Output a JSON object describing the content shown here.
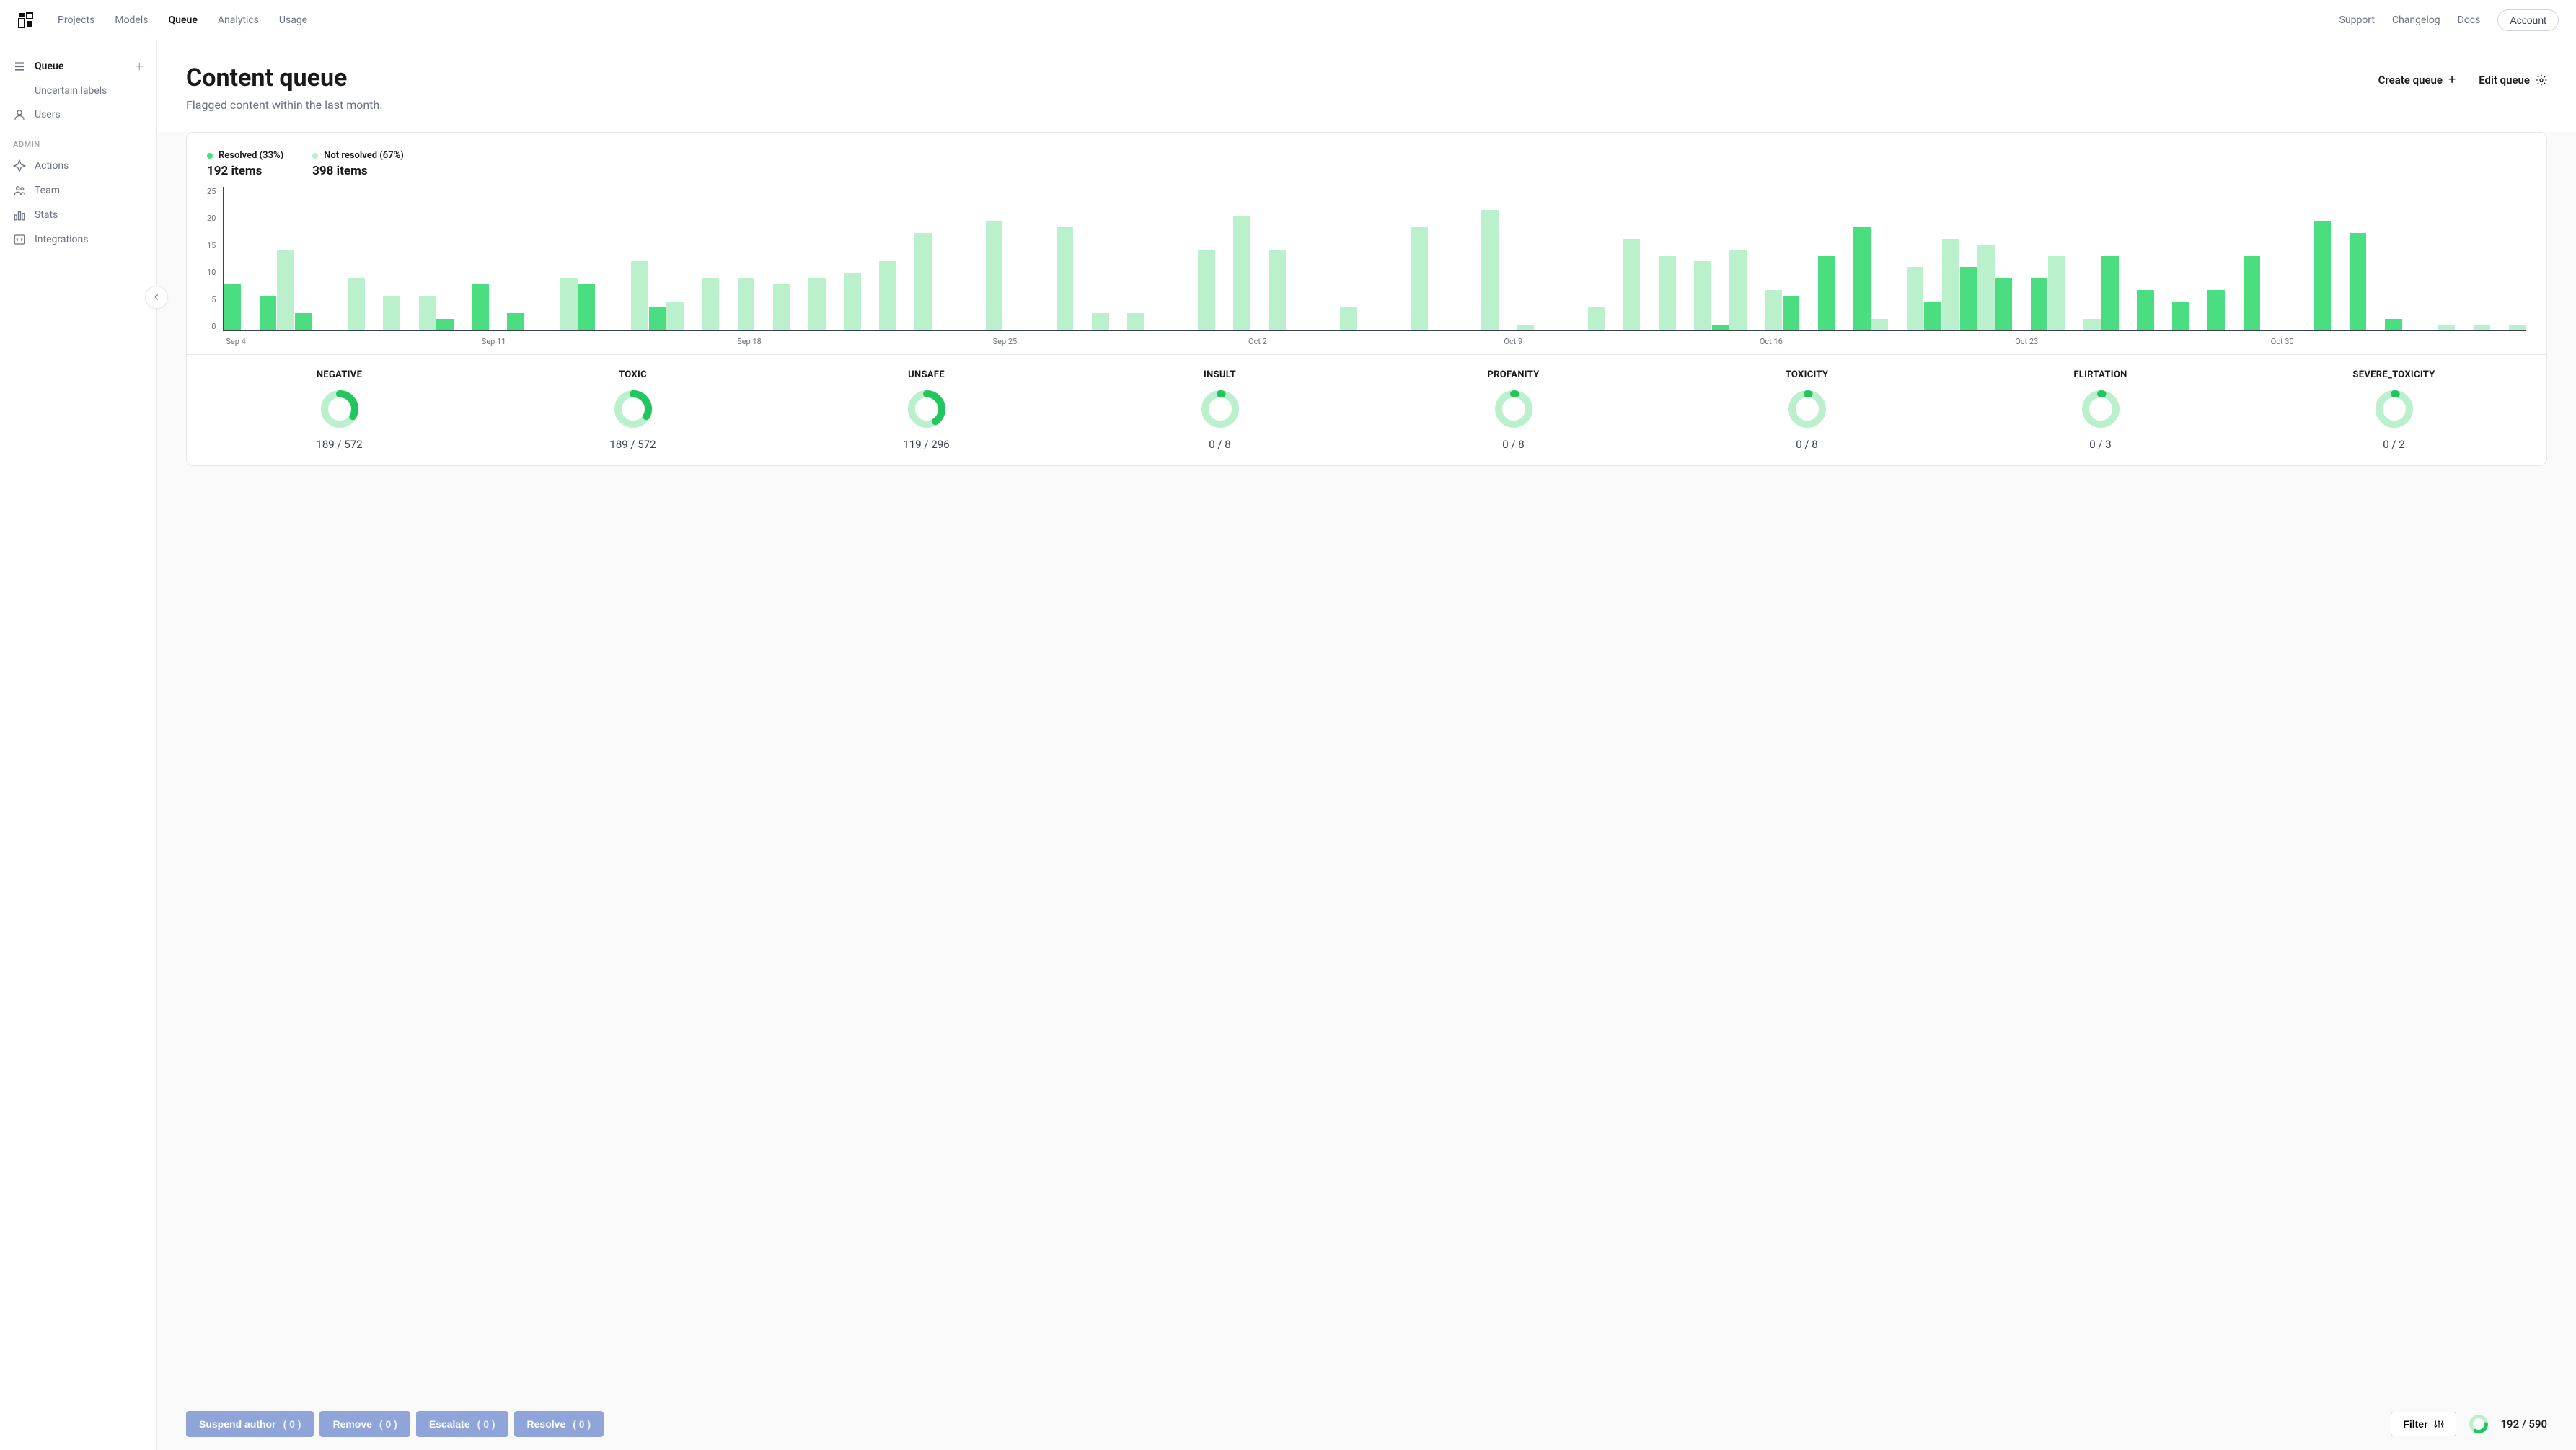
{
  "topnav": {
    "links": [
      "Projects",
      "Models",
      "Queue",
      "Analytics",
      "Usage"
    ],
    "active": "Queue",
    "right": [
      "Support",
      "Changelog",
      "Docs"
    ],
    "account": "Account"
  },
  "sidebar": {
    "queue_label": "Queue",
    "items": [
      {
        "label": "Uncertain labels",
        "sub": true
      },
      {
        "label": "Users",
        "icon": "user"
      }
    ],
    "admin_label": "ADMIN",
    "admin_items": [
      {
        "label": "Actions",
        "icon": "cursor"
      },
      {
        "label": "Team",
        "icon": "team"
      },
      {
        "label": "Stats",
        "icon": "bars"
      },
      {
        "label": "Integrations",
        "icon": "code"
      }
    ]
  },
  "page": {
    "title": "Content queue",
    "subtitle": "Flagged content within the last month.",
    "create_label": "Create queue",
    "edit_label": "Edit queue"
  },
  "legend": {
    "resolved": {
      "label": "Resolved (33%)",
      "count": "192 items",
      "color": "#4ade80"
    },
    "unresolved": {
      "label": "Not resolved (67%)",
      "count": "398 items",
      "color": "#bbf0cc"
    }
  },
  "chart_data": {
    "type": "bar",
    "ylabel": "",
    "ylim": [
      0,
      25
    ],
    "yticks": [
      0,
      5,
      10,
      15,
      20,
      25
    ],
    "xticks": [
      "Sep 4",
      "Sep 11",
      "Sep 18",
      "Sep 25",
      "Oct 2",
      "Oct 9",
      "Oct 16",
      "Oct 23",
      "Oct 30"
    ],
    "series": [
      {
        "name": "Resolved",
        "color": "#4ade80",
        "values": [
          8,
          6,
          3,
          0,
          0,
          0,
          2,
          8,
          3,
          0,
          8,
          0,
          4,
          0,
          0,
          0,
          0,
          0,
          0,
          0,
          0,
          0,
          0,
          0,
          0,
          0,
          0,
          0,
          0,
          0,
          0,
          0,
          0,
          0,
          0,
          0,
          0,
          0,
          0,
          0,
          0,
          0,
          1,
          0,
          6,
          13,
          18,
          0,
          5,
          11,
          9,
          9,
          0,
          13,
          7,
          5,
          7,
          13,
          0,
          19,
          17,
          2,
          0
        ]
      },
      {
        "name": "Not resolved",
        "color": "#bbf0cc",
        "values": [
          0,
          14,
          0,
          9,
          6,
          6,
          0,
          0,
          0,
          9,
          0,
          12,
          5,
          9,
          9,
          8,
          9,
          10,
          12,
          17,
          0,
          19,
          0,
          18,
          3,
          3,
          0,
          14,
          20,
          14,
          0,
          4,
          0,
          18,
          0,
          21,
          1,
          0,
          4,
          16,
          13,
          12,
          14,
          7,
          0,
          0,
          2,
          11,
          16,
          15,
          0,
          13,
          2,
          0,
          0,
          0,
          0,
          0,
          0,
          0,
          0,
          0,
          1,
          1,
          1
        ]
      }
    ]
  },
  "categories": [
    {
      "label": "NEGATIVE",
      "resolved": 189,
      "total": 572
    },
    {
      "label": "TOXIC",
      "resolved": 189,
      "total": 572
    },
    {
      "label": "UNSAFE",
      "resolved": 119,
      "total": 296
    },
    {
      "label": "INSULT",
      "resolved": 0,
      "total": 8
    },
    {
      "label": "PROFANITY",
      "resolved": 0,
      "total": 8
    },
    {
      "label": "TOXICITY",
      "resolved": 0,
      "total": 8
    },
    {
      "label": "FLIRTATION",
      "resolved": 0,
      "total": 3
    },
    {
      "label": "SEVERE_TOXICITY",
      "resolved": 0,
      "total": 2
    }
  ],
  "bottom": {
    "actions": [
      {
        "label": "Suspend author",
        "count": 0
      },
      {
        "label": "Remove",
        "count": 0
      },
      {
        "label": "Escalate",
        "count": 0
      },
      {
        "label": "Resolve",
        "count": 0
      }
    ],
    "filter_label": "Filter",
    "total": {
      "resolved": 192,
      "total": 590
    }
  },
  "colors": {
    "green": "#4ade80",
    "lightgreen": "#bbf0cc"
  }
}
